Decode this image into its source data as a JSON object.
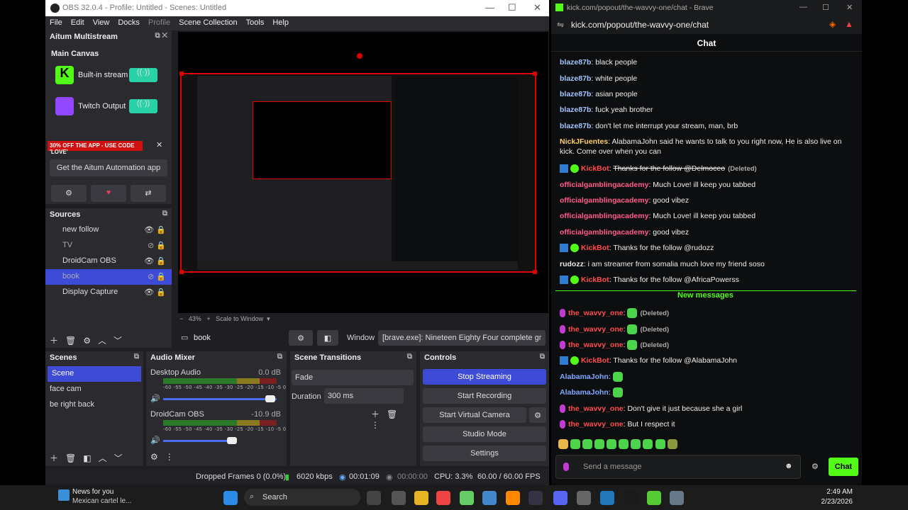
{
  "obs": {
    "title": "OBS 32.0.4 - Profile: Untitled - Scenes: Untitled",
    "menu": [
      "File",
      "Edit",
      "View",
      "Docks",
      "Profile",
      "Scene Collection",
      "Tools",
      "Help"
    ],
    "aitum": {
      "title": "Aitum Multistream",
      "canvas": "Main Canvas",
      "outputs": [
        "Built-in stream",
        "Twitch Output"
      ],
      "promo": "30% OFF THE APP - USE CODE 'LOVE'",
      "app_button": "Get the Aitum Automation app"
    },
    "sources": {
      "title": "Sources",
      "items": [
        "new follow",
        "TV",
        "DroidCam OBS",
        "book",
        "Display Capture"
      ]
    },
    "zoom": {
      "value": "43%",
      "mode": "Scale to Window"
    },
    "source_bar": {
      "name": "book",
      "window_label": "Window",
      "window_value": "[brave.exe]: Nineteen Eighty Four complete gr"
    },
    "scenes": {
      "title": "Scenes",
      "items": [
        "Scene",
        "face cam",
        "be right back"
      ]
    },
    "mixer": {
      "title": "Audio Mixer",
      "channels": [
        {
          "name": "Desktop Audio",
          "db": "0.0 dB"
        },
        {
          "name": "DroidCam OBS",
          "db": "-10.9 dB"
        }
      ],
      "scale": [
        "-60",
        "-55",
        "-50",
        "-45",
        "-40",
        "-35",
        "-30",
        "-25",
        "-20",
        "-15",
        "-10",
        "-5",
        "0"
      ]
    },
    "transitions": {
      "title": "Scene Transitions",
      "type": "Fade",
      "duration_label": "Duration",
      "duration": "300 ms"
    },
    "controls": {
      "title": "Controls",
      "buttons": [
        "Stop Streaming",
        "Start Recording",
        "Start Virtual Camera",
        "Studio Mode",
        "Settings"
      ]
    },
    "status": {
      "dropped": "Dropped Frames 0 (0.0%)",
      "kbps": "6020 kbps",
      "live": "00:01:09",
      "rec": "00:00:00",
      "cpu": "CPU: 3.3%",
      "fps": "60.00 / 60.00 FPS"
    }
  },
  "chat": {
    "title": "kick.com/popout/the-wavvy-one/chat - Brave",
    "url": "kick.com/popout/the-wavvy-one/chat",
    "header": "Chat",
    "new_messages": "New messages",
    "input_placeholder": "Send a message",
    "send": "Chat",
    "messages": [
      {
        "user": "blaze87b",
        "color": "#a3c6ff",
        "text": "black people"
      },
      {
        "user": "blaze87b",
        "color": "#a3c6ff",
        "text": "white people"
      },
      {
        "user": "blaze87b",
        "color": "#a3c6ff",
        "text": "asian people"
      },
      {
        "user": "blaze87b",
        "color": "#a3c6ff",
        "text": "fuck yeah brother"
      },
      {
        "user": "blaze87b",
        "color": "#a3c6ff",
        "text": "don't let me interrupt your stream, man, brb"
      },
      {
        "user": "NickJFuentes",
        "color": "#ffd166",
        "text": "AlabamaJohn said he wants to talk to you right now, He is also live on kick. Come over when you can"
      },
      {
        "user": "KickBot",
        "color": "#ff4d4d",
        "text": "Thanks for the follow @Delmoceo",
        "deleted": "(Deleted)",
        "bot": true
      },
      {
        "user": "officialgamblingacademy",
        "color": "#ff5c8a",
        "text": "Much Love! ill keep you tabbed"
      },
      {
        "user": "officialgamblingacademy",
        "color": "#ff5c8a",
        "text": "good vibez"
      },
      {
        "user": "officialgamblingacademy",
        "color": "#ff5c8a",
        "text": "Much Love! ill keep you tabbed"
      },
      {
        "user": "officialgamblingacademy",
        "color": "#ff5c8a",
        "text": "good vibez"
      },
      {
        "user": "KickBot",
        "color": "#ff4d4d",
        "text": "Thanks for the follow @rudozz",
        "bot": true
      },
      {
        "user": "rudozz",
        "color": "#e8e8e8",
        "text": "i am streamer from somalia much love my friend soso"
      },
      {
        "user": "KickBot",
        "color": "#ff4d4d",
        "text": "Thanks for the follow @AfricaPowerss",
        "bot": true
      },
      {
        "user": "the_wavvy_one",
        "color": "#ff4d4d",
        "text": "",
        "deleted": "(Deleted)",
        "mic": true
      },
      {
        "user": "the_wavvy_one",
        "color": "#ff4d4d",
        "text": "",
        "deleted": "(Deleted)",
        "mic": true
      },
      {
        "user": "the_wavvy_one",
        "color": "#ff4d4d",
        "text": "",
        "deleted": "(Deleted)",
        "mic": true
      },
      {
        "user": "KickBot",
        "color": "#ff4d4d",
        "text": "Thanks for the follow @AlabamaJohn",
        "bot": true
      },
      {
        "user": "AlabamaJohn",
        "color": "#7fa8ff",
        "text": ""
      },
      {
        "user": "AlabamaJohn",
        "color": "#7fa8ff",
        "text": ""
      },
      {
        "user": "the_wavvy_one",
        "color": "#ff4d4d",
        "text": "Don't give it just because she a girl",
        "mic": true
      },
      {
        "user": "the_wavvy_one",
        "color": "#ff4d4d",
        "text": "But I respect it",
        "mic": true
      }
    ]
  },
  "taskbar": {
    "news_title": "News for you",
    "news_sub": "Mexican cartel le...",
    "search": "Search",
    "time": "2:49 AM",
    "date": "2/23/2026"
  }
}
